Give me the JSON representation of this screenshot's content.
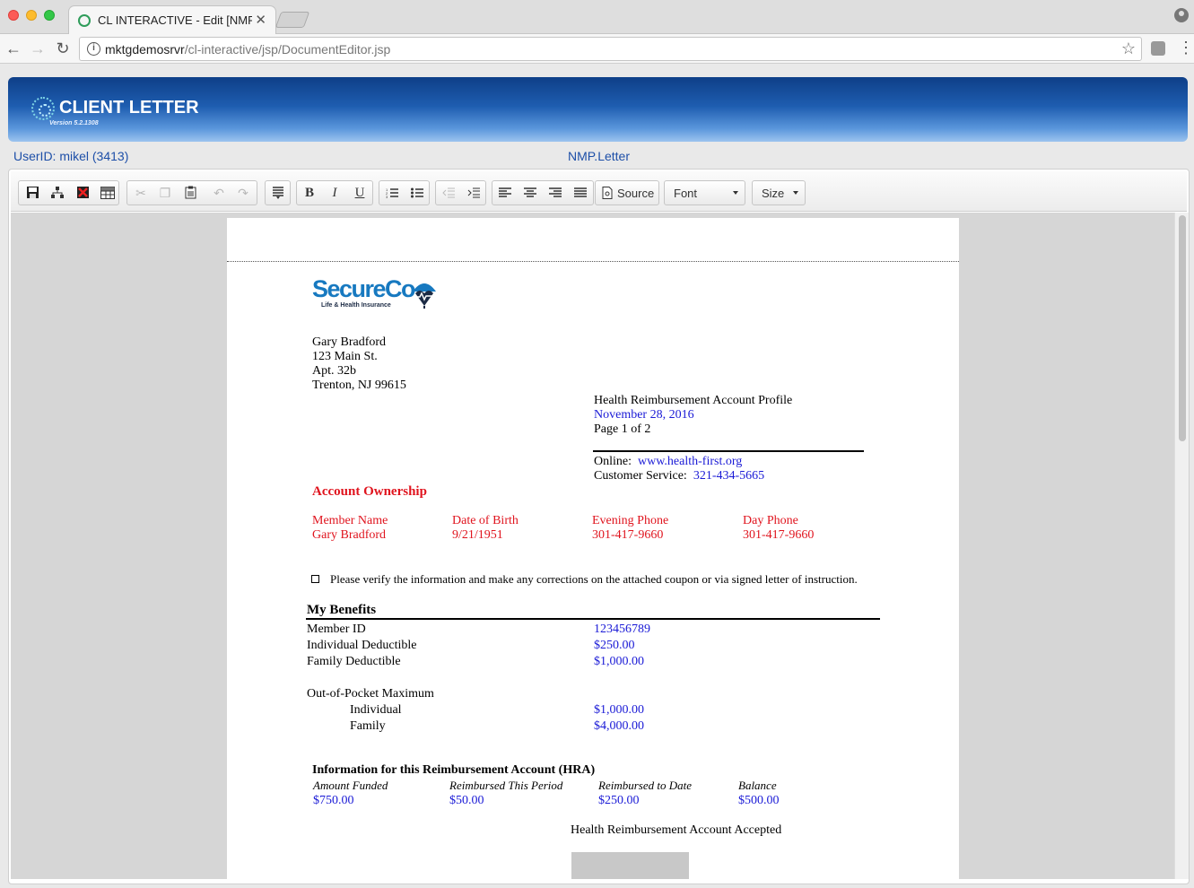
{
  "browser": {
    "tab_title": "CL INTERACTIVE - Edit [NMP.L",
    "url_host": "mktgdemosrvr",
    "url_path": "/cl-interactive/jsp/DocumentEditor.jsp"
  },
  "app": {
    "title": "CLIENT LETTER",
    "version": "Version 5.2.1308",
    "user_id": "UserID: mikel (3413)",
    "document_name": "NMP.Letter"
  },
  "editor_toolbar": {
    "source_label": "Source",
    "font_label": "Font",
    "size_label": "Size",
    "icons": [
      "save-icon",
      "structure-icon",
      "delete-icon",
      "table-icon",
      "cut-icon",
      "copy-icon",
      "paste-icon",
      "undo-icon",
      "redo-icon",
      "show-blocks-icon",
      "bold-icon",
      "italic-icon",
      "underline-icon",
      "numbered-list-icon",
      "bulleted-list-icon",
      "outdent-icon",
      "indent-icon",
      "align-left-icon",
      "align-center-icon",
      "align-right-icon",
      "justify-icon",
      "source-icon"
    ]
  },
  "letter": {
    "logo_text": "SecureCo",
    "logo_tagline": "Life & Health Insurance",
    "address": [
      "Gary Bradford",
      "123 Main St.",
      "Apt. 32b",
      "Trenton, NJ  99615"
    ],
    "profile_title": "Health Reimbursement Account Profile",
    "profile_date": "November 28, 2016",
    "page_info": "Page 1 of 2",
    "online_label": "Online:",
    "online_url": "www.health-first.org",
    "customer_service_label": "Customer Service:",
    "customer_service_phone": "321-434-5665",
    "ownership_title": "Account Ownership",
    "ownership_headers": [
      "Member Name",
      "Date of Birth",
      "Evening Phone",
      "Day Phone"
    ],
    "ownership_values": [
      "Gary Bradford",
      "9/21/1951",
      "301-417-9660",
      "301-417-9660"
    ],
    "verify_text": "Please verify the information and make any corrections on the attached coupon or via signed letter of instruction.",
    "benefits_title": "My Benefits",
    "benefits": [
      {
        "label": "Member ID",
        "value": "123456789"
      },
      {
        "label": "Individual Deductible",
        "value": "$250.00"
      },
      {
        "label": "Family Deductible",
        "value": "$1,000.00"
      }
    ],
    "oop_label": "Out-of-Pocket Maximum",
    "oop": [
      {
        "label": "Individual",
        "value": "$1,000.00"
      },
      {
        "label": "Family",
        "value": "$4,000.00"
      }
    ],
    "hra_title": "Information for this Reimbursement Account (HRA)",
    "hra_headers": [
      "Amount Funded",
      "Reimbursed This Period",
      "Reimbursed to Date",
      "Balance"
    ],
    "hra_values": [
      "$750.00",
      "$50.00",
      "$250.00",
      "$500.00"
    ],
    "hra_accepted": "Health Reimbursement Account Accepted"
  }
}
